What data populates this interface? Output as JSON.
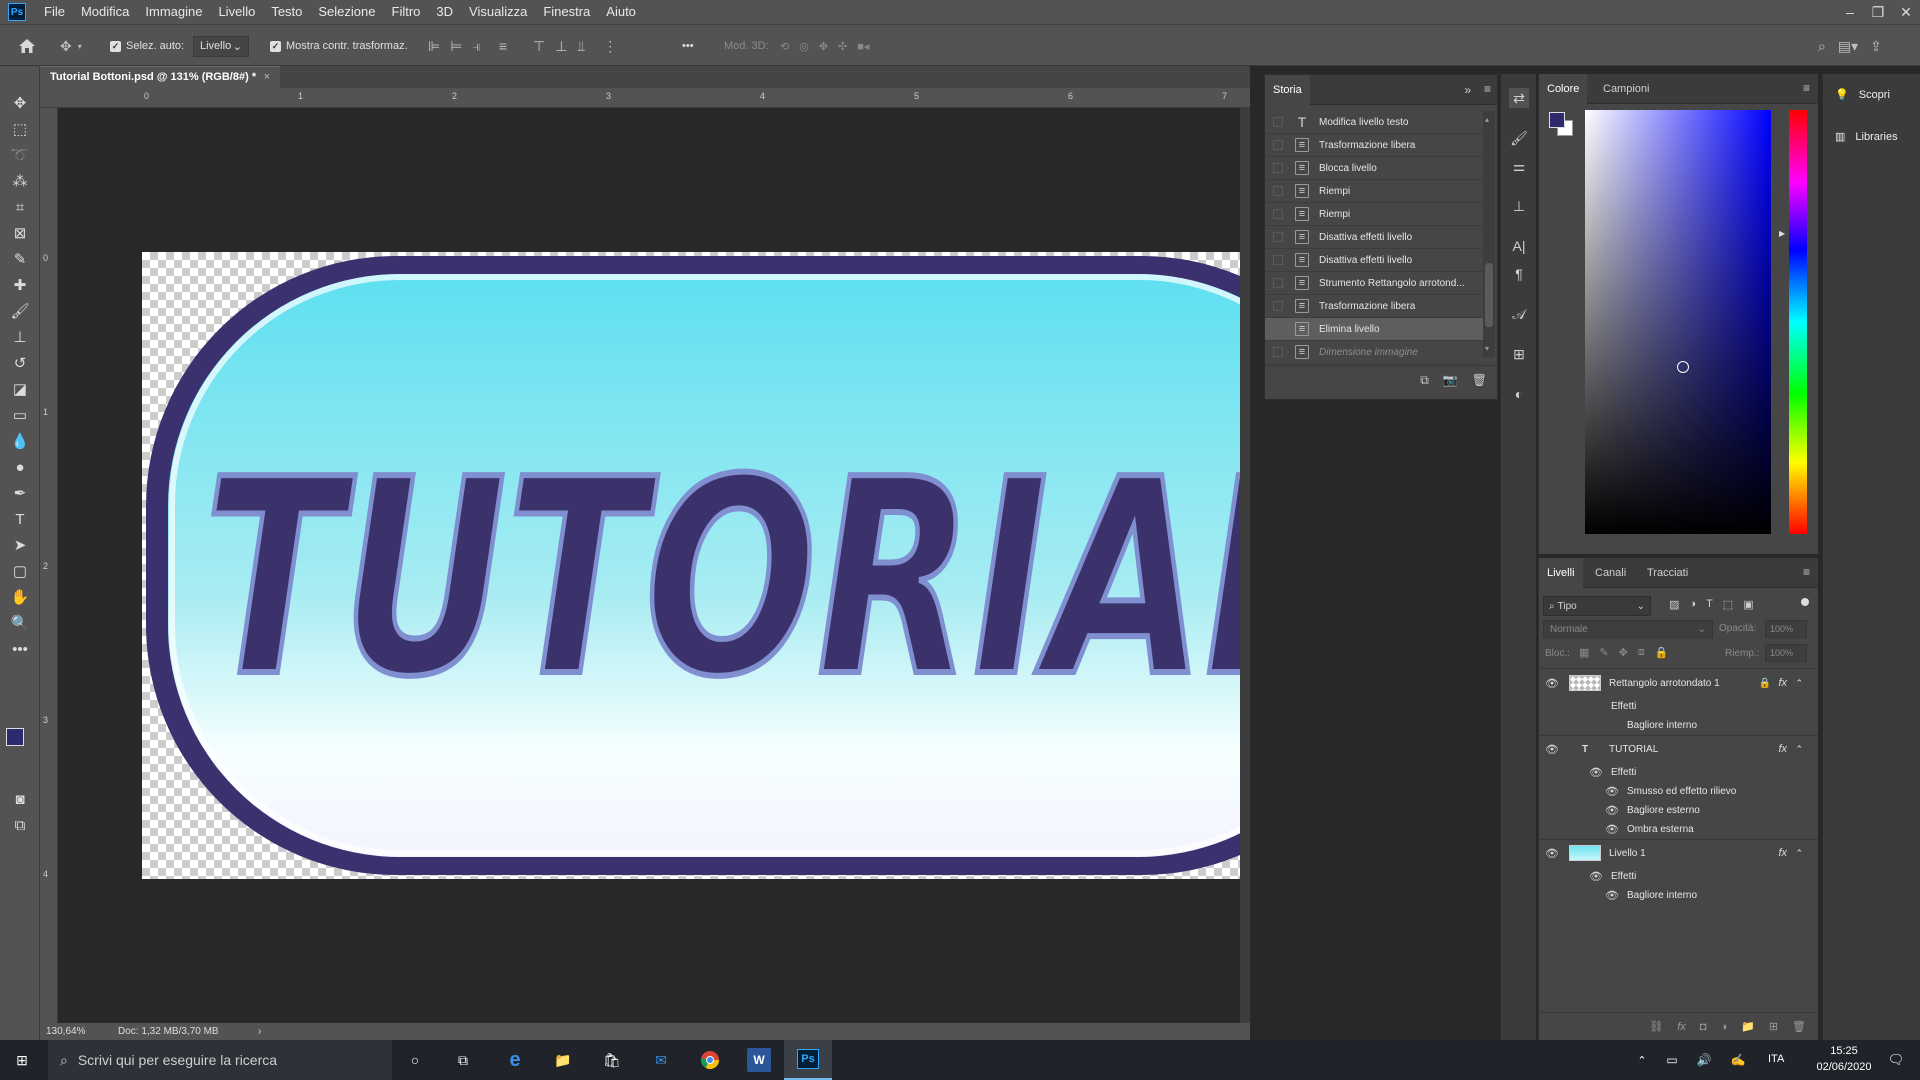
{
  "app": {
    "logo": "Ps"
  },
  "menu": [
    "File",
    "Modifica",
    "Immagine",
    "Livello",
    "Testo",
    "Selezione",
    "Filtro",
    "3D",
    "Visualizza",
    "Finestra",
    "Aiuto"
  ],
  "options": {
    "auto_select_label": "Selez. auto:",
    "auto_select_value": "Livello",
    "show_transform_label": "Mostra contr. trasformaz.",
    "mode3d_label": "Mod. 3D:",
    "more": "•••"
  },
  "document": {
    "tab_title": "Tutorial Bottoni.psd @ 131% (RGB/8#) *",
    "close": "×",
    "zoom": "130,64%",
    "doc_info": "Doc: 1,32 MB/3,70 MB",
    "status_arrow": "›"
  },
  "ruler": {
    "top": [
      "0",
      "1",
      "2",
      "3",
      "4",
      "5",
      "6",
      "7"
    ],
    "left": [
      "0",
      "1",
      "2",
      "3",
      "4"
    ]
  },
  "canvas_art": {
    "text": "TUTORIAL",
    "pill_border_color": "#3b316e",
    "pill_top_color": "#5ee0f0",
    "pill_bottom_color": "#f4f4ff",
    "text_color": "#3b326c",
    "text_outline_color": "#7f8fd0"
  },
  "history": {
    "tab": "Storia",
    "rows": [
      {
        "label": "Modifica livello testo",
        "icon": "type-icon"
      },
      {
        "label": "Trasformazione libera",
        "icon": "document-icon"
      },
      {
        "label": "Blocca livello",
        "icon": "document-icon"
      },
      {
        "label": "Riempi",
        "icon": "document-icon"
      },
      {
        "label": "Riempi",
        "icon": "document-icon"
      },
      {
        "label": "Disattiva effetti livello",
        "icon": "document-icon"
      },
      {
        "label": "Disattiva effetti livello",
        "icon": "document-icon"
      },
      {
        "label": "Strumento Rettangolo arrotond...",
        "icon": "document-icon"
      },
      {
        "label": "Trasformazione libera",
        "icon": "document-icon"
      },
      {
        "label": "Elimina livello",
        "icon": "document-icon",
        "selected": true
      },
      {
        "label": "Dimensione immagine",
        "icon": "document-icon",
        "dimmed": true
      }
    ]
  },
  "color_panel": {
    "tabs": [
      "Colore",
      "Campioni"
    ],
    "foreground": "#2f2a6e",
    "background": "#ffffff",
    "hue": "#0000ff"
  },
  "layers_panel": {
    "tabs": [
      "Livelli",
      "Canali",
      "Tracciati"
    ],
    "filter": "Tipo",
    "blend_mode": "Normale",
    "opacity_label": "Opacità:",
    "opacity_value": "100%",
    "lock_label": "Bloc.:",
    "fill_label": "Riemp.:",
    "fill_value": "100%",
    "layers": [
      {
        "name": "Rettangolo arrotondato 1",
        "effects_label": "Effetti",
        "effects": [
          "Bagliore interno"
        ]
      },
      {
        "name": "TUTORIAL",
        "effects_label": "Effetti",
        "effects": [
          "Smusso ed effetto rilievo",
          "Bagliore esterno",
          "Ombra esterna"
        ]
      },
      {
        "name": "Livello 1",
        "effects_label": "Effetti",
        "effects": [
          "Bagliore interno"
        ]
      }
    ]
  },
  "learn_panel": {
    "items": [
      "Scopri",
      "Libraries"
    ]
  },
  "taskbar": {
    "search_placeholder": "Scrivi qui per eseguire la ricerca",
    "lang": "ITA",
    "time": "15:25",
    "date": "02/06/2020"
  }
}
